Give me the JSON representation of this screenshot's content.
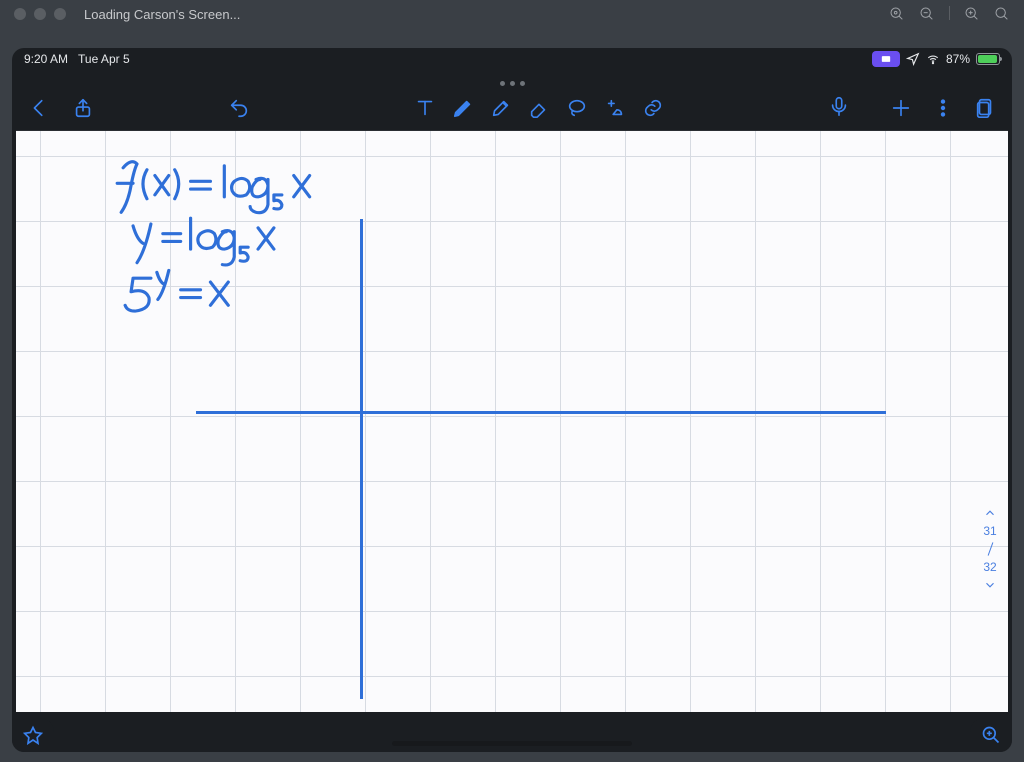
{
  "window": {
    "title": "Loading Carson's Screen..."
  },
  "status": {
    "time": "9:20 AM",
    "date": "Tue Apr 5",
    "battery_pct": "87%"
  },
  "handwriting": {
    "line1": "f(x) = log₅ x",
    "line2": "y = log₅ x",
    "line3": "5ʸ = x"
  },
  "pages": {
    "current": "31",
    "total": "32"
  },
  "colors": {
    "ink": "#2f6fd8",
    "toolbar_accent": "#3a82f0"
  }
}
